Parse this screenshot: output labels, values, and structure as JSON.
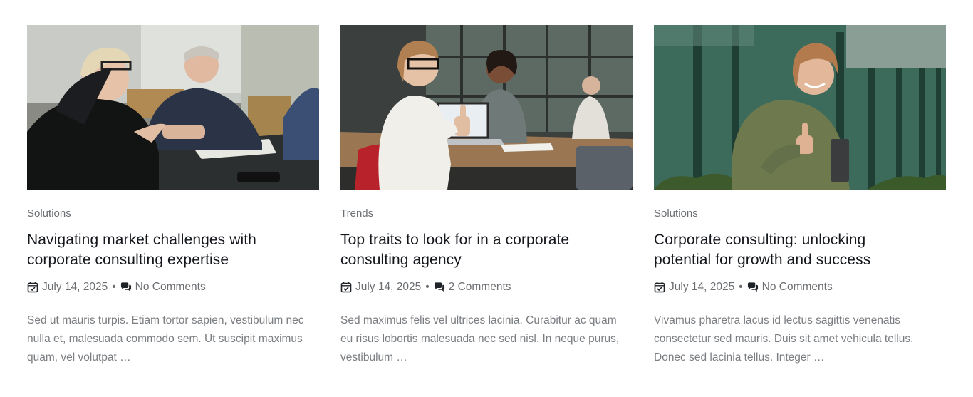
{
  "posts": [
    {
      "category": "Solutions",
      "title": "Navigating market challenges with corporate consulting expertise",
      "date": "July 14, 2025",
      "separator": "•",
      "comments": "No Comments",
      "excerpt": "Sed ut mauris turpis. Etiam tortor sapien, vestibulum nec nulla et, malesuada commodo sem. Ut suscipit maximus quam, vel volutpat …",
      "icons": [
        "calendar-check-icon",
        "comments-icon"
      ]
    },
    {
      "category": "Trends",
      "title": "Top traits to look for in a corporate consulting agency",
      "date": "July 14, 2025",
      "separator": "•",
      "comments": "2 Comments",
      "excerpt": "Sed maximus felis vel ultrices lacinia. Curabitur ac quam eu risus lobortis malesuada nec sed nisl. In neque purus, vestibulum …",
      "icons": [
        "calendar-check-icon",
        "comments-icon"
      ]
    },
    {
      "category": "Solutions",
      "title": "Corporate consulting: unlocking potential for growth and success",
      "date": "July 14, 2025",
      "separator": "•",
      "comments": "No Comments",
      "excerpt": "Vivamus pharetra lacus id lectus sagittis venenatis consectetur sed mauris. Duis sit amet vehicula tellus. Donec sed lacinia tellus. Integer …",
      "icons": [
        "calendar-check-icon",
        "comments-icon"
      ]
    }
  ],
  "colors": {
    "title": "#14171c",
    "meta": "#6b6e72",
    "excerpt": "#7a7d81",
    "icon": "#1f2328"
  }
}
